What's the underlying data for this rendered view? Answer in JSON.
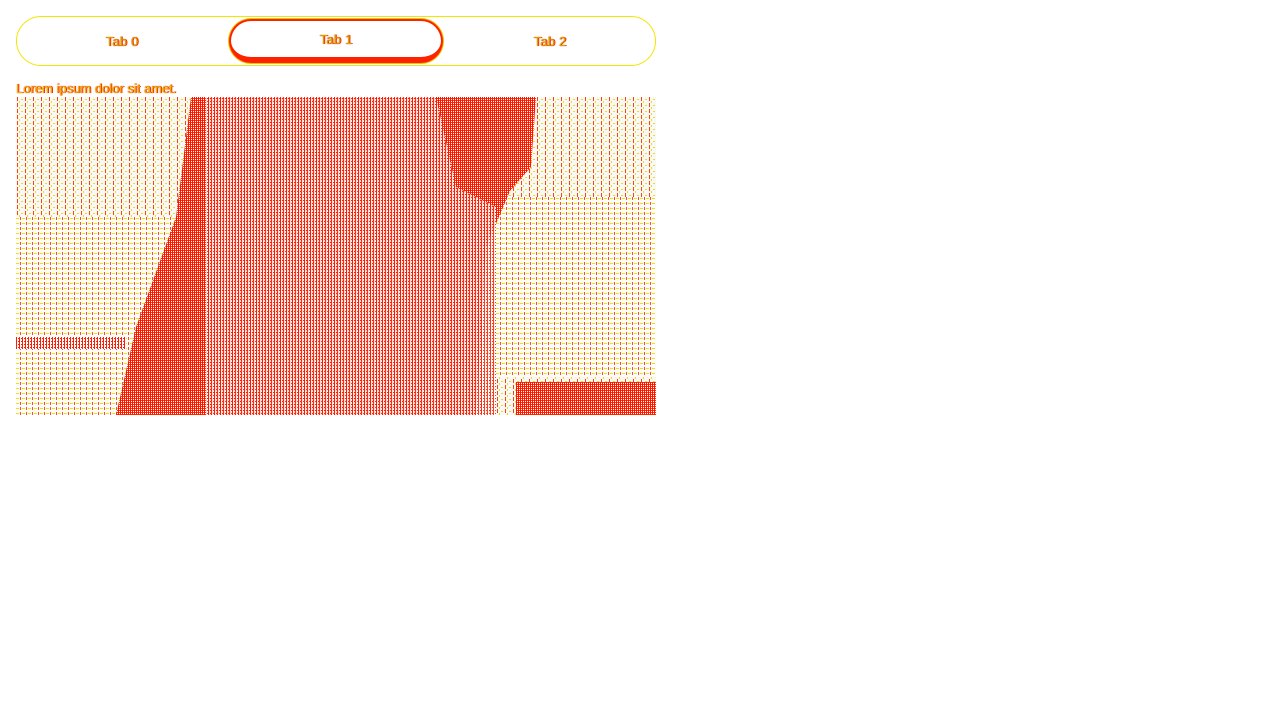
{
  "tabs": [
    {
      "label": "Tab 0"
    },
    {
      "label": "Tab 1"
    },
    {
      "label": "Tab 2"
    }
  ],
  "active_tab": 1,
  "content": {
    "caption": "Lorem ipsum dolor sit amet.",
    "image": "photo"
  },
  "colors": {
    "accent": "#ff2200",
    "highlight": "#f2e600",
    "background": "#ffffff"
  }
}
